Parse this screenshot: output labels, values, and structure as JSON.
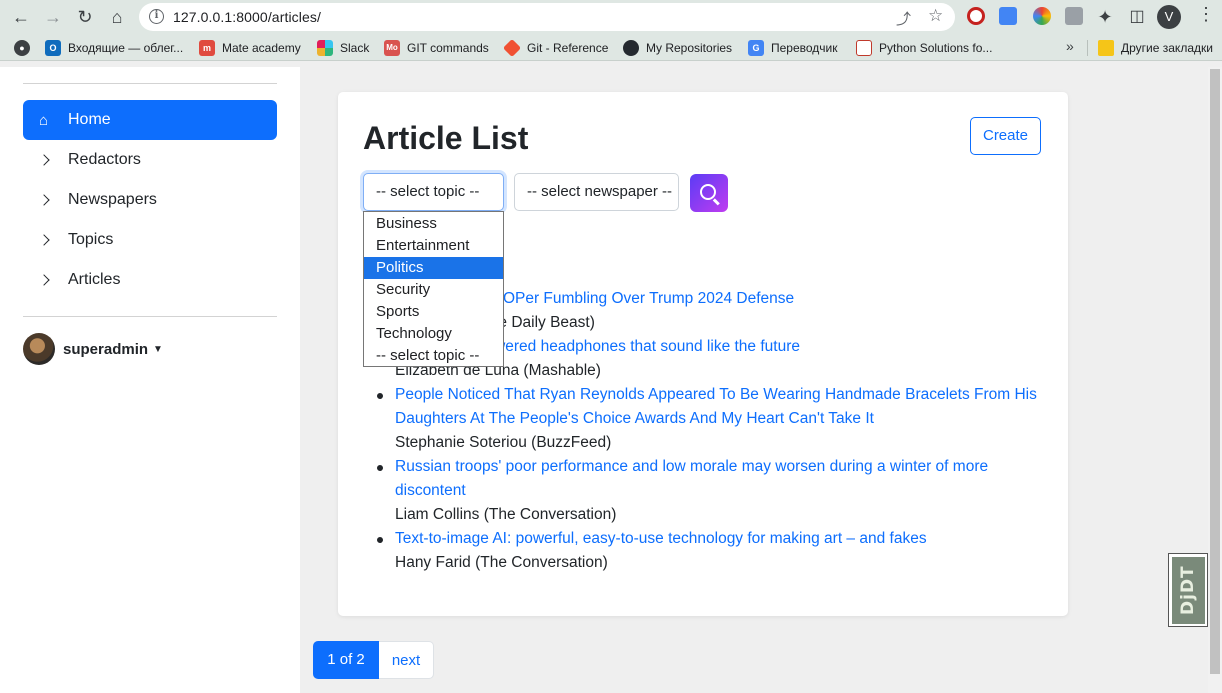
{
  "browser": {
    "url": "127.0.0.1:8000/articles/",
    "profile_initial": "V",
    "bookmarks": [
      {
        "label": "Входящие — облег...",
        "icon": "outlook-icon",
        "color": "#0f6cbd",
        "glyph": "O"
      },
      {
        "label": "Mate academy",
        "icon": "mate-academy-icon",
        "color": "#e04b3f",
        "glyph": "m"
      },
      {
        "label": "Slack",
        "icon": "slack-icon",
        "color": "#4a154b",
        "glyph": "#"
      },
      {
        "label": "GIT commands",
        "icon": "git-commands-icon",
        "color": "#d9534f",
        "glyph": "Mo"
      },
      {
        "label": "Git - Reference",
        "icon": "git-icon",
        "color": "#f05133",
        "glyph": "◆"
      },
      {
        "label": "My Repositories",
        "icon": "github-icon",
        "color": "#24292f",
        "glyph": "●"
      },
      {
        "label": "Переводчик",
        "icon": "translate-icon",
        "color": "#4285f4",
        "glyph": "G"
      },
      {
        "label": "Python Solutions fo...",
        "icon": "python-solutions-icon",
        "color": "#c0392b",
        "glyph": "⚙"
      }
    ],
    "more_bookmarks": "»",
    "other_bookmarks": "Другие закладки"
  },
  "sidebar": {
    "items": [
      {
        "label": "Home",
        "active": true
      },
      {
        "label": "Redactors"
      },
      {
        "label": "Newspapers"
      },
      {
        "label": "Topics"
      },
      {
        "label": "Articles"
      }
    ],
    "user": "superadmin"
  },
  "main": {
    "title": "Article List",
    "create_label": "Create",
    "topic_select": "-- select topic --",
    "newspaper_select": "-- select newspaper --",
    "topic_options": [
      "Business",
      "Entertainment",
      "Politics",
      "Security",
      "Sports",
      "Technology",
      "-- select topic --"
    ],
    "highlighted_option": "Politics",
    "articles": [
      {
        "title": "Trump Slams GOPer Fumbling Over Trump 2024 Defense",
        "meta": "Jake Lahut (The Daily Beast)"
      },
      {
        "title": "I tried solar-powered headphones that sound like the future",
        "meta": "Elizabeth de Luna (Mashable)"
      },
      {
        "title": "People Noticed That Ryan Reynolds Appeared To Be Wearing Handmade Bracelets From His Daughters At The People's Choice Awards And My Heart Can't Take It",
        "meta": "Stephanie Soteriou (BuzzFeed)"
      },
      {
        "title": "Russian troops' poor performance and low morale may worsen during a winter of more discontent",
        "meta": "Liam Collins (The Conversation)"
      },
      {
        "title": "Text-to-image AI: powerful, easy-to-use technology for making art – and fakes",
        "meta": "Hany Farid (The Conversation)"
      }
    ]
  },
  "pagination": {
    "current": "1 of 2",
    "next": "next"
  },
  "debug_toolbar": "DjDT"
}
